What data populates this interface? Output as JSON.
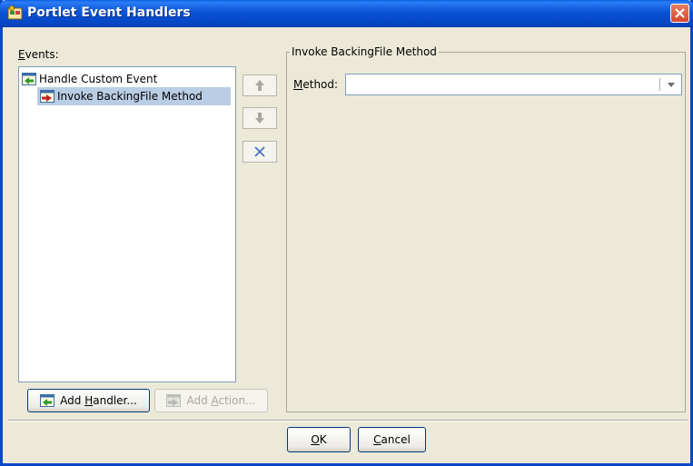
{
  "window": {
    "title": "Portlet Event Handlers",
    "close_icon": "close-icon"
  },
  "events": {
    "label_mnemonic": "E",
    "label_rest": "vents:",
    "tree": [
      {
        "label": "Handle Custom Event",
        "icon": "event-handler-icon",
        "level": 0,
        "selected": false
      },
      {
        "label": "Invoke BackingFile Method",
        "icon": "action-icon",
        "level": 1,
        "selected": true
      }
    ],
    "reorder_buttons": [
      {
        "name": "move-up-button",
        "icon": "arrow-up-icon",
        "enabled": false
      },
      {
        "name": "move-down-button",
        "icon": "arrow-down-icon",
        "enabled": false
      },
      {
        "name": "remove-button",
        "icon": "remove-icon",
        "enabled": true
      }
    ],
    "add_handler": {
      "pre": "Add ",
      "mnemonic": "H",
      "post": "andler...",
      "icon": "event-handler-icon"
    },
    "add_action": {
      "pre": "Add ",
      "mnemonic": "A",
      "post": "ction...",
      "icon": "action-icon",
      "enabled": false
    }
  },
  "details": {
    "group_title": "Invoke BackingFile Method",
    "method_label_mnemonic": "M",
    "method_label_rest": "ethod:",
    "method_value": ""
  },
  "footer": {
    "ok_mnemonic": "O",
    "ok_rest": "K",
    "cancel_mnemonic": "C",
    "cancel_rest": "ancel"
  },
  "colors": {
    "titlebar": "#0a53d8",
    "dialog_bg": "#ece9d8",
    "selection": "#b9cde5",
    "close_button": "#d5462a"
  }
}
